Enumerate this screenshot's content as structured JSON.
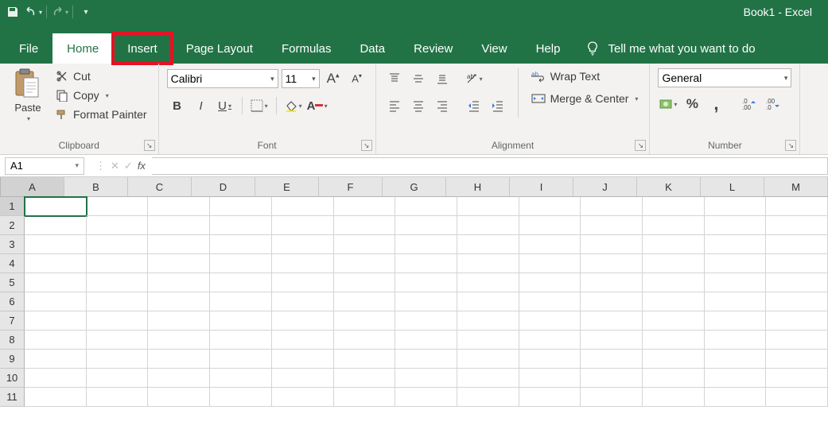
{
  "title": "Book1  -  Excel",
  "qat": {
    "save": "save",
    "undo": "undo",
    "redo": "redo"
  },
  "tabs": [
    {
      "label": "File",
      "active": false,
      "highlight": false
    },
    {
      "label": "Home",
      "active": true,
      "highlight": false
    },
    {
      "label": "Insert",
      "active": false,
      "highlight": true
    },
    {
      "label": "Page Layout",
      "active": false,
      "highlight": false
    },
    {
      "label": "Formulas",
      "active": false,
      "highlight": false
    },
    {
      "label": "Data",
      "active": false,
      "highlight": false
    },
    {
      "label": "Review",
      "active": false,
      "highlight": false
    },
    {
      "label": "View",
      "active": false,
      "highlight": false
    },
    {
      "label": "Help",
      "active": false,
      "highlight": false
    }
  ],
  "tell_me": "Tell me what you want to do",
  "clipboard": {
    "paste": "Paste",
    "cut": "Cut",
    "copy": "Copy",
    "format_painter": "Format Painter",
    "group": "Clipboard"
  },
  "font": {
    "name": "Calibri",
    "size": "11",
    "group": "Font"
  },
  "alignment": {
    "wrap": "Wrap Text",
    "merge": "Merge & Center",
    "group": "Alignment"
  },
  "number": {
    "format": "General",
    "group": "Number",
    "percent": "%",
    "comma": ",",
    "inc": ".0",
    "dec": ".00"
  },
  "name_box": "A1",
  "formula": "",
  "columns": [
    "A",
    "B",
    "C",
    "D",
    "E",
    "F",
    "G",
    "H",
    "I",
    "J",
    "K",
    "L",
    "M"
  ],
  "rows": [
    "1",
    "2",
    "3",
    "4",
    "5",
    "6",
    "7",
    "8",
    "9",
    "10",
    "11"
  ],
  "selected": {
    "col": "A",
    "row": "1"
  },
  "style": "B",
  "italic": "I",
  "under": "U",
  "incfont": "A",
  "decfont": "A"
}
